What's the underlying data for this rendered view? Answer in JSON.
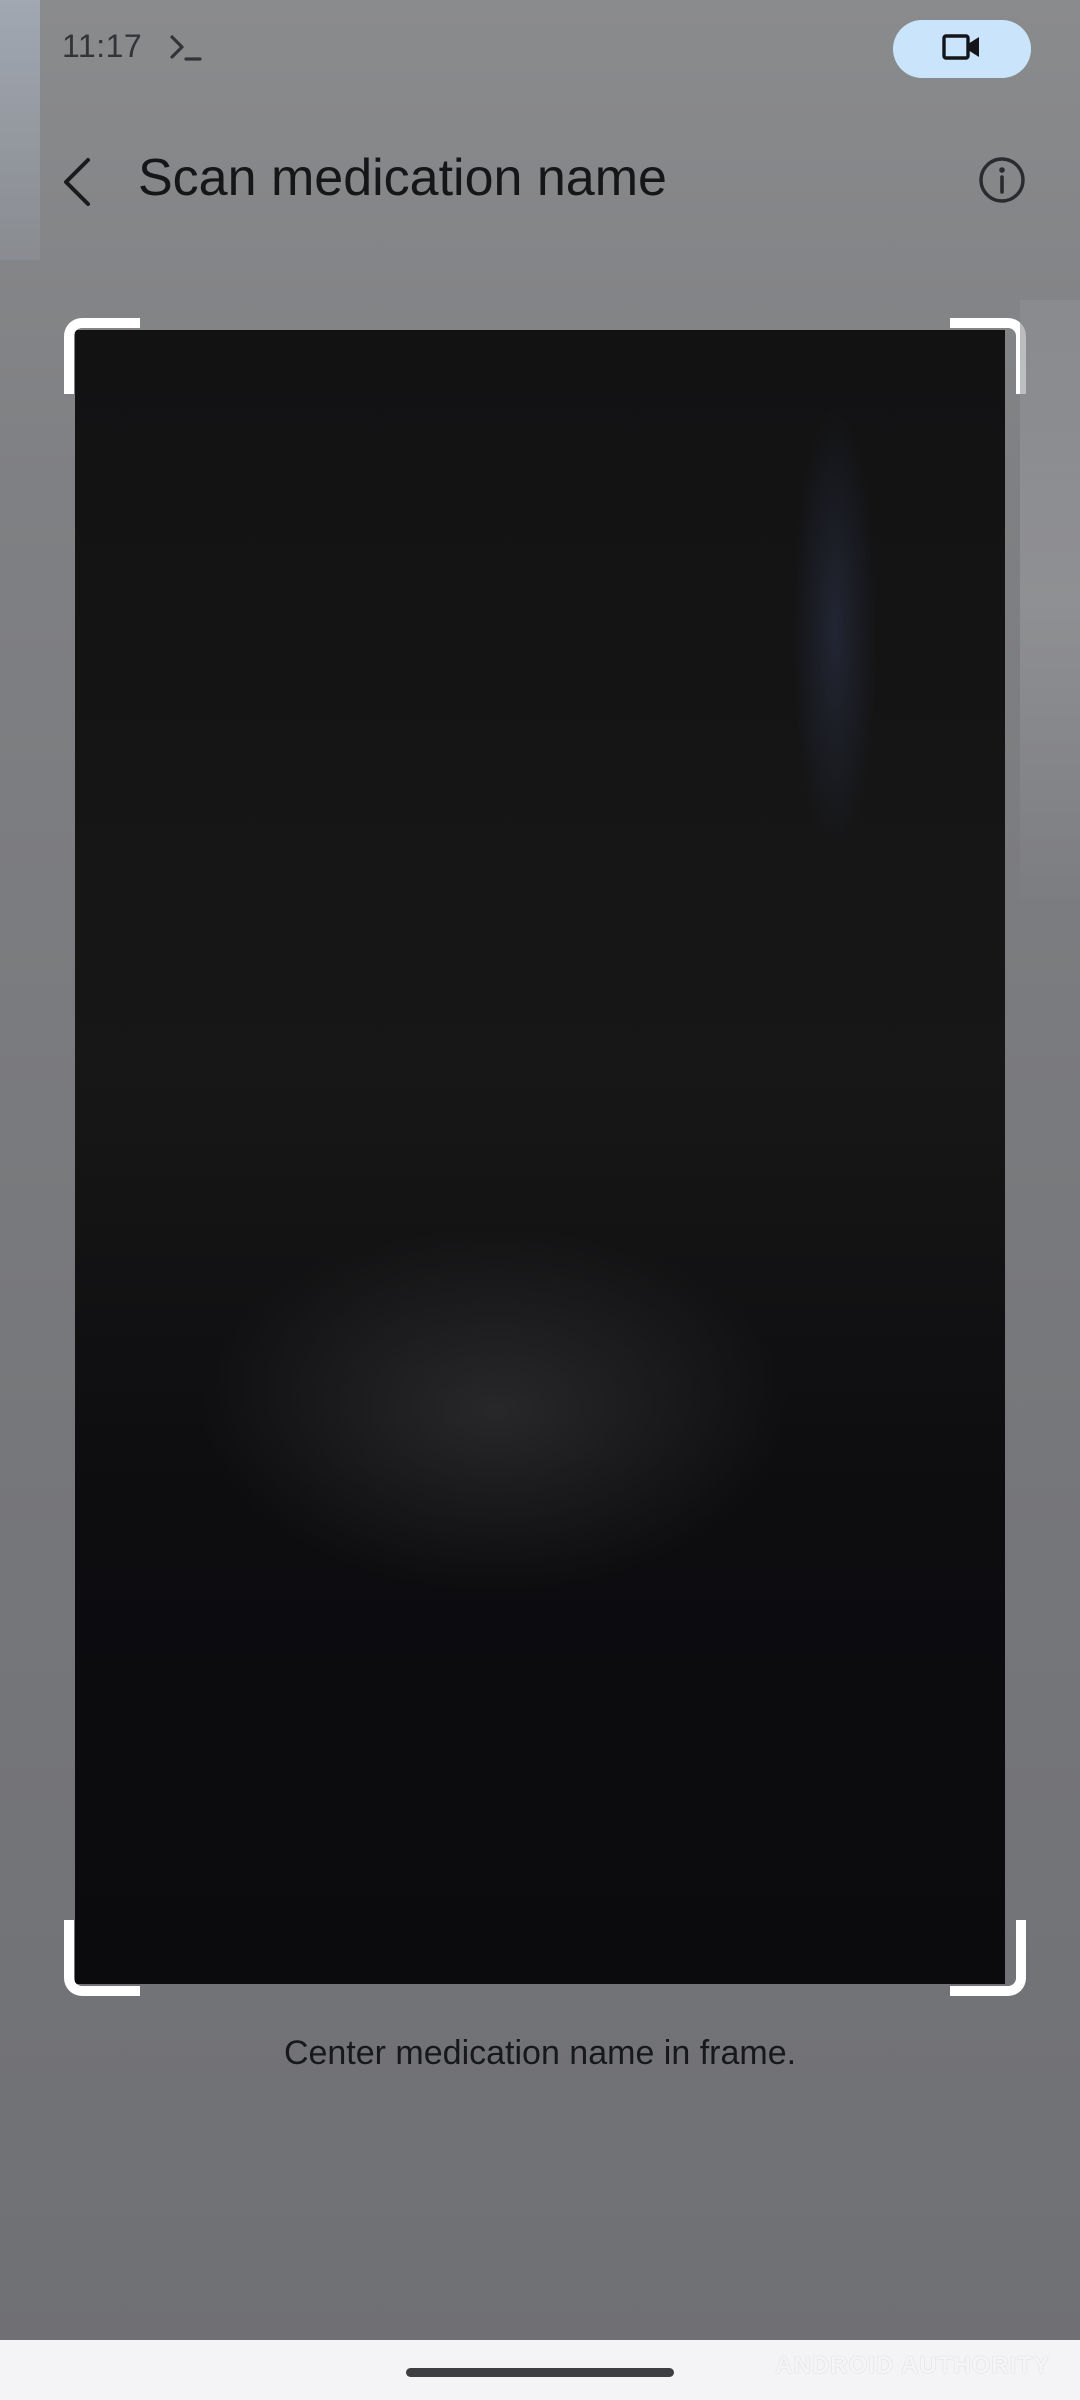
{
  "status_bar": {
    "time": "11:17",
    "terminal_icon": "terminal-prompt-icon",
    "recording_icon": "videocam-icon",
    "recording_chip_color": "#c9e4fb"
  },
  "app_bar": {
    "title": "Scan medication name",
    "back_icon": "chevron-left-icon",
    "info_icon": "info-outline-icon"
  },
  "viewfinder": {
    "hint": "Center medication name in frame.",
    "frame_color": "#ffffff"
  },
  "watermark": {
    "text": "ANDROID AUTHORITY"
  }
}
